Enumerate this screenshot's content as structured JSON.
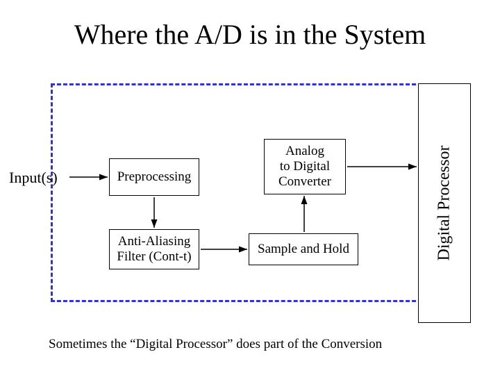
{
  "title": "Where the A/D is in the System",
  "input_label": "Input(s)",
  "blocks": {
    "preprocessing": "Preprocessing",
    "adc": "Analog\nto Digital\nConverter",
    "anti_aliasing": "Anti-Aliasing\nFilter (Cont-t)",
    "sample_hold": "Sample and Hold"
  },
  "digital_processor": "Digital Processor",
  "caption": "Sometimes the “Digital Processor” does part of the Conversion"
}
